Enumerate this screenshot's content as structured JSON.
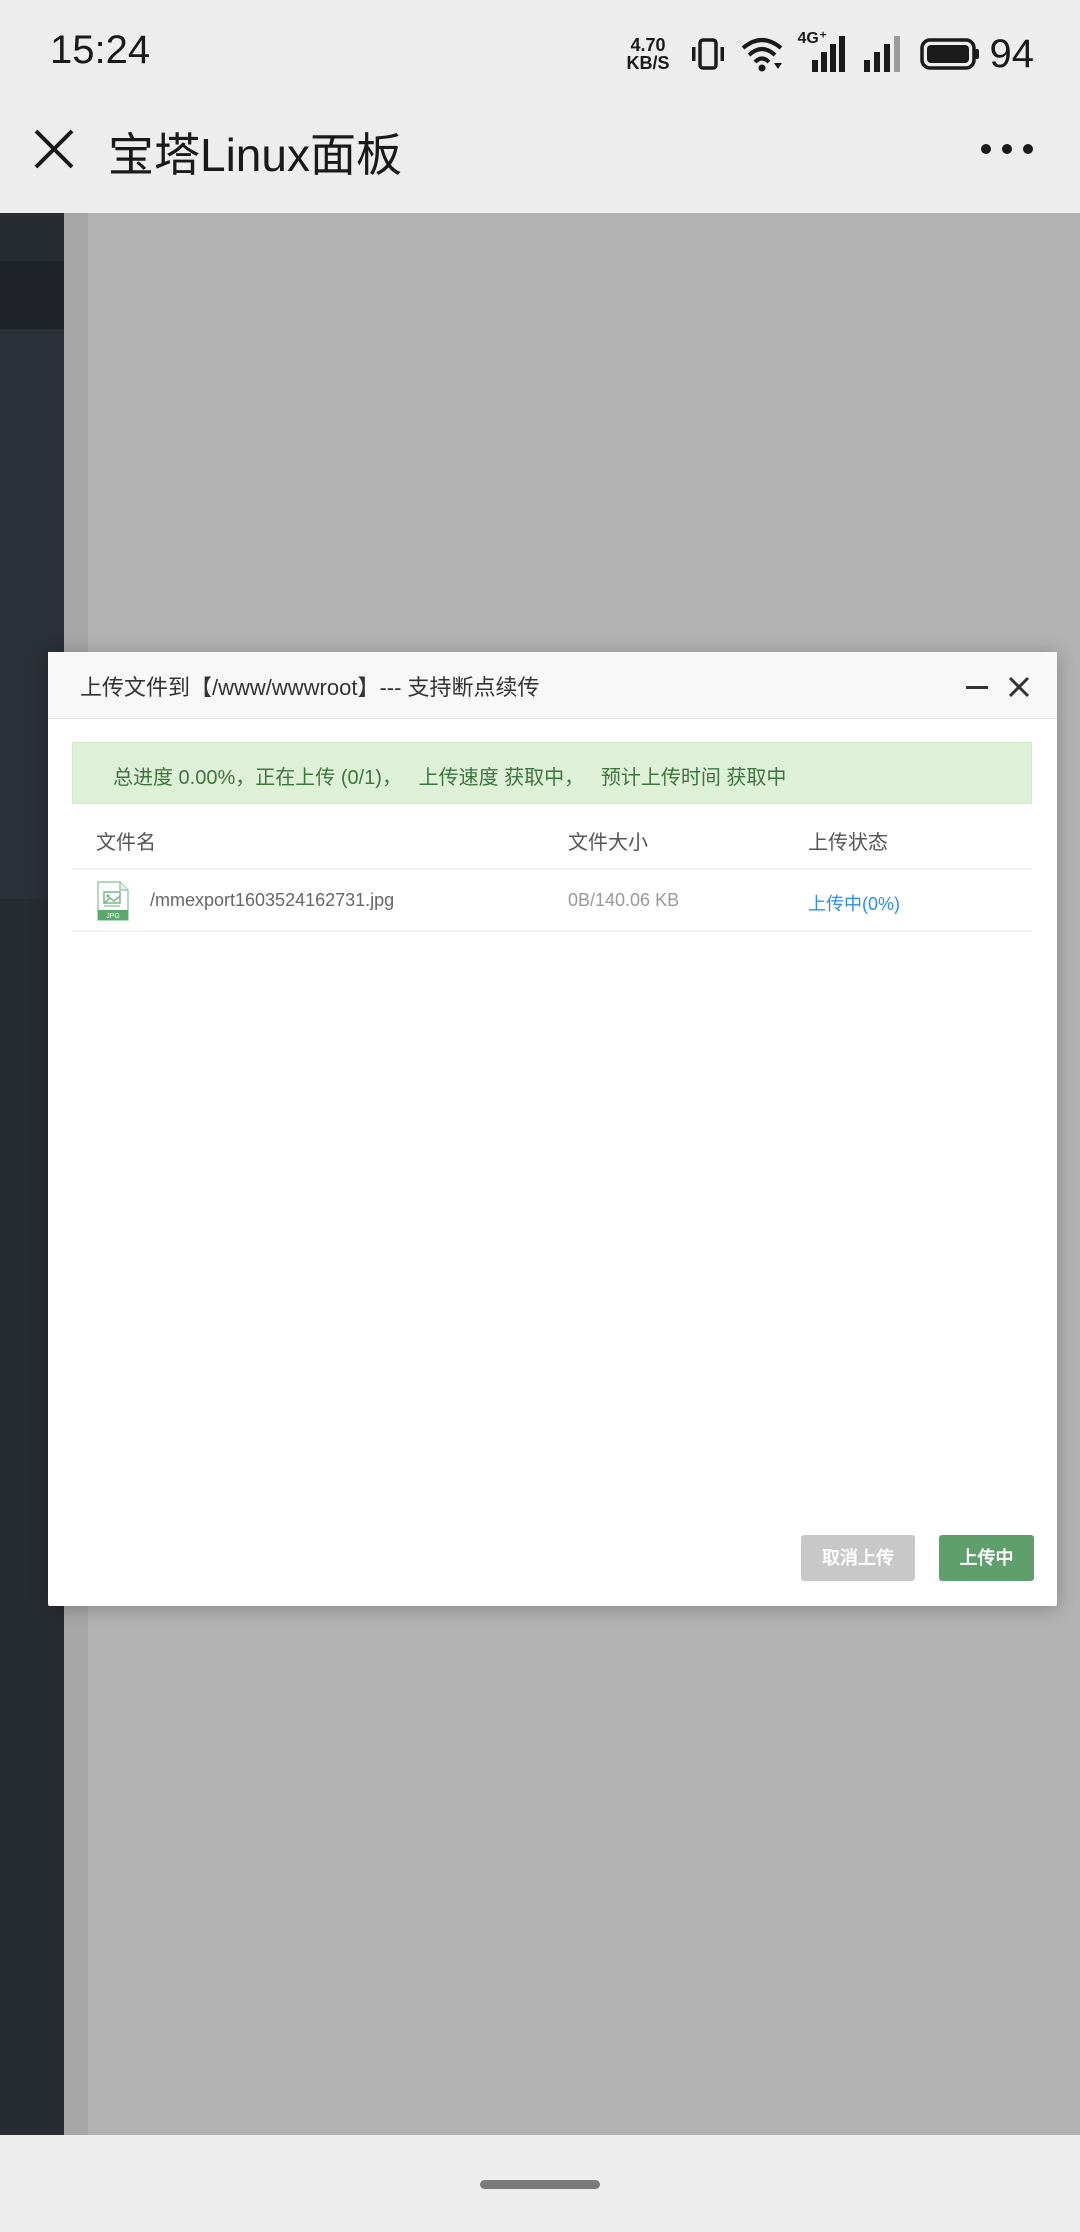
{
  "status_bar": {
    "time": "15:24",
    "net_speed_value": "4.70",
    "net_speed_unit": "KB/S",
    "network_type": "4G⁺",
    "battery": "94"
  },
  "title_bar": {
    "title": "宝塔Linux面板"
  },
  "dialog": {
    "title": "上传文件到【/www/wwwroot】--- 支持断点续传",
    "progress": "总进度 0.00%，正在上传 (0/1)，   上传速度 获取中，   预计上传时间 获取中",
    "columns": [
      "文件名",
      "文件大小",
      "上传状态"
    ],
    "files": [
      {
        "name": "/mmexport1603524162731.jpg",
        "size": "0B/140.06 KB",
        "status": "上传中(0%)",
        "type_label": "JPG"
      }
    ],
    "cancel_button": "取消上传",
    "upload_button": "上传中"
  }
}
